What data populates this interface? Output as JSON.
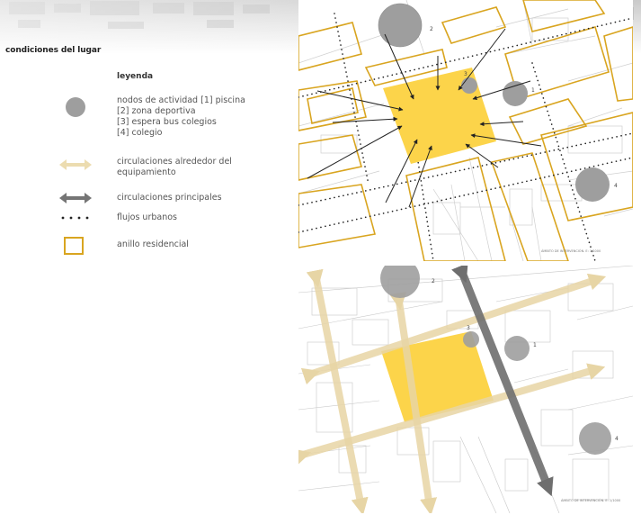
{
  "title": "condiciones del lugar",
  "legend": {
    "heading": "leyenda",
    "items": [
      {
        "kind": "nodes",
        "lines": [
          "nodos de actividad [1] piscina",
          "[2] zona deportiva",
          "[3] espera bus colegios",
          "[4] colegio"
        ]
      },
      {
        "kind": "equip-circulation",
        "lines": [
          "circulaciones alrededor del",
          "equipamiento"
        ]
      },
      {
        "kind": "main-circulation",
        "lines": [
          "circulaciones principales"
        ]
      },
      {
        "kind": "urban-flows",
        "lines": [
          "flujos urbanos"
        ]
      },
      {
        "kind": "residential-ring",
        "lines": [
          "anillo residencial"
        ]
      }
    ]
  },
  "colors": {
    "node": "#9e9e9e",
    "equipment": "#fcd44a",
    "ring": "#d9a520",
    "equip_arrow": "#ecdcb0",
    "main_arrow": "#757575"
  },
  "maps": {
    "top": {
      "node_labels": [
        "1",
        "2",
        "3",
        "4"
      ],
      "footnote": "ÁMBITO DE INTERVENCIÓN. E: 1/1000"
    },
    "bottom": {
      "node_labels": [
        "1",
        "2",
        "3",
        "4"
      ],
      "footnote": "ÁMBITO DE INTERVENCIÓN. E: 1/1000"
    }
  }
}
